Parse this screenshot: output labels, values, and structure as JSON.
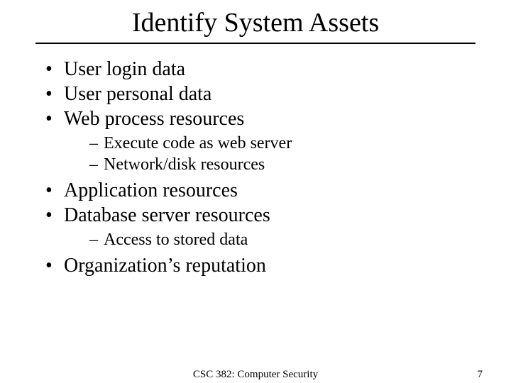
{
  "title": "Identify System Assets",
  "bullets": {
    "b0": "User login data",
    "b1": "User personal data",
    "b2": "Web process resources",
    "b2_sub": {
      "s0": "Execute code as web server",
      "s1": "Network/disk resources"
    },
    "b3": "Application resources",
    "b4": "Database server resources",
    "b4_sub": {
      "s0": "Access to stored data"
    },
    "b5": "Organization’s reputation"
  },
  "footer": {
    "course": "CSC 382: Computer Security",
    "page": "7"
  }
}
